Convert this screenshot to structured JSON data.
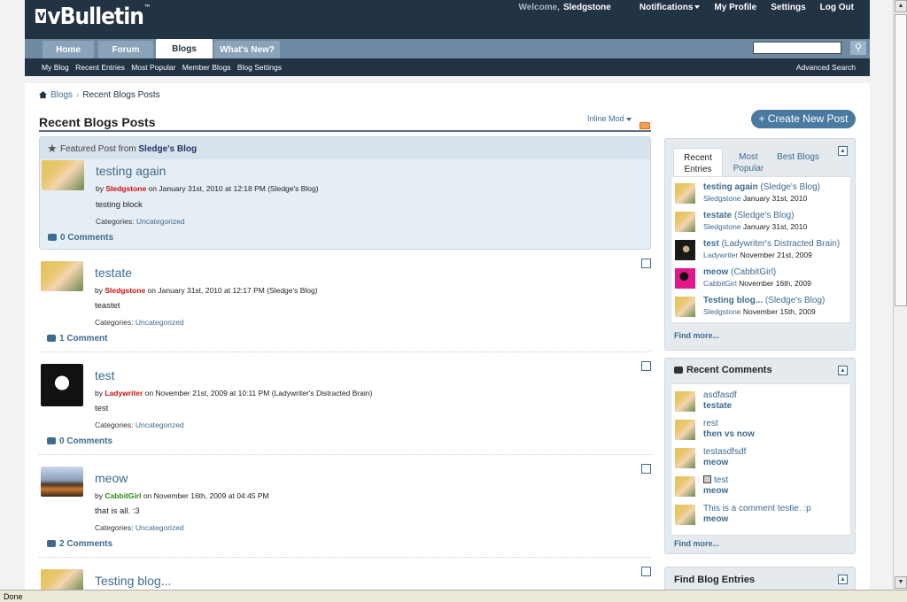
{
  "header": {
    "logo": "vBulletin",
    "welcome": "Welcome,",
    "username": "Sledgstone",
    "links": [
      "Notifications",
      "My Profile",
      "Settings",
      "Log Out"
    ]
  },
  "nav": {
    "tabs": [
      "Home",
      "Forum",
      "Blogs",
      "What's New?"
    ],
    "active": "Blogs",
    "search_value": ""
  },
  "subnav": {
    "items": [
      "My Blog",
      "Recent Entries",
      "Most Popular",
      "Member Blogs",
      "Blog Settings"
    ],
    "advanced": "Advanced Search"
  },
  "breadcrumb": {
    "root": "Blogs",
    "current": "Recent Blogs Posts"
  },
  "page_title": "Recent Blogs Posts",
  "inline_mod": "Inline Mod",
  "featured": {
    "label": "Featured Post from",
    "blog": "Sledge's Blog"
  },
  "posts": [
    {
      "title": "testing again",
      "by": "by",
      "author": "Sledgstone",
      "meta": "on January 31st, 2010 at 12:18 PM (Sledge's Blog)",
      "body": "testing block",
      "cats_label": "Categories:",
      "category": "Uncategorized",
      "comments": "0 Comments"
    },
    {
      "title": "testate",
      "by": "by",
      "author": "Sledgstone",
      "meta": "on January 31st, 2010 at 12:17 PM (Sledge's Blog)",
      "body": "teastet",
      "cats_label": "Categories:",
      "category": "Uncategorized",
      "comments": "1 Comment"
    },
    {
      "title": "test",
      "by": "by",
      "author": "Ladywriter",
      "meta": "on November 21st, 2009 at 10:11 PM (Ladywriter's Distracted Brain)",
      "body": "test",
      "cats_label": "Categories:",
      "category": "Uncategorized",
      "comments": "0 Comments"
    },
    {
      "title": "meow",
      "by": "by",
      "author": "CabbitGirl",
      "meta": "on November 16th, 2009 at 04:45 PM",
      "body": "that is all. :3",
      "cats_label": "Categories:",
      "category": "Uncategorized",
      "comments": "2 Comments"
    },
    {
      "title": "Testing blog..."
    }
  ],
  "sidebar": {
    "create_button": "+ Create New Post",
    "tabs": [
      "Recent Entries",
      "Most Popular",
      "Best Blogs"
    ],
    "entries": [
      {
        "title": "testing again",
        "blog": "(Sledge's Blog)",
        "user": "Sledgstone",
        "date": "January 31st, 2010"
      },
      {
        "title": "testate",
        "blog": "(Sledge's Blog)",
        "user": "Sledgstone",
        "date": "January 31st, 2010"
      },
      {
        "title": "test",
        "blog": "(Ladywriter's Distracted Brain)",
        "user": "Ladywriter",
        "date": "November 21st, 2009"
      },
      {
        "title": "meow",
        "blog": "(CabbitGirl)",
        "user": "CabbitGirl",
        "date": "November 16th, 2009"
      },
      {
        "title": "Testing blog...",
        "blog": "(Sledge's Blog)",
        "user": "Sledgstone",
        "date": "November 15th, 2009"
      }
    ],
    "find_more": "Find more...",
    "recent_comments_title": "Recent Comments",
    "comments": [
      {
        "text": "asdfasdf",
        "entry": "testate"
      },
      {
        "text": "rest",
        "entry": "then vs now"
      },
      {
        "text": "testasdfsdf",
        "entry": "meow"
      },
      {
        "text": "test",
        "entry": "meow"
      },
      {
        "text": "This is a comment testie. :p",
        "entry": "meow"
      }
    ],
    "find_entries_title": "Find Blog Entries"
  },
  "status": "Done"
}
